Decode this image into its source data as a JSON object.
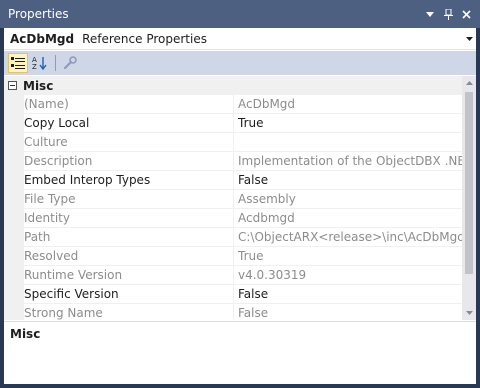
{
  "titlebar": {
    "title": "Properties",
    "dropdown_icon": "chevron-down-icon",
    "pin_icon": "pin-icon",
    "close_icon": "close-icon"
  },
  "object_selector": {
    "name": "AcDbMgd",
    "type": "Reference Properties"
  },
  "toolbar": {
    "buttons": [
      {
        "icon": "categorized-icon",
        "active": true
      },
      {
        "icon": "alphabetical-icon",
        "active": false
      },
      {
        "icon": "property-pages-icon",
        "active": false
      }
    ]
  },
  "grid": {
    "category": "Misc",
    "rows": [
      {
        "name": "(Name)",
        "value": "AcDbMgd",
        "readonly": true
      },
      {
        "name": "Copy Local",
        "value": "True",
        "readonly": false
      },
      {
        "name": "Culture",
        "value": "",
        "readonly": true
      },
      {
        "name": "Description",
        "value": "Implementation of the ObjectDBX .NET M",
        "readonly": true
      },
      {
        "name": "Embed Interop Types",
        "value": "False",
        "readonly": false
      },
      {
        "name": "File Type",
        "value": "Assembly",
        "readonly": true
      },
      {
        "name": "Identity",
        "value": "Acdbmgd",
        "readonly": true
      },
      {
        "name": "Path",
        "value": "C:\\ObjectARX<release>\\inc\\AcDbMgd.dll",
        "readonly": true
      },
      {
        "name": "Resolved",
        "value": "True",
        "readonly": true
      },
      {
        "name": "Runtime Version",
        "value": "v4.0.30319",
        "readonly": true
      },
      {
        "name": "Specific Version",
        "value": "False",
        "readonly": false
      },
      {
        "name": "Strong Name",
        "value": "False",
        "readonly": true
      }
    ]
  },
  "description_panel": {
    "title": "Misc"
  }
}
